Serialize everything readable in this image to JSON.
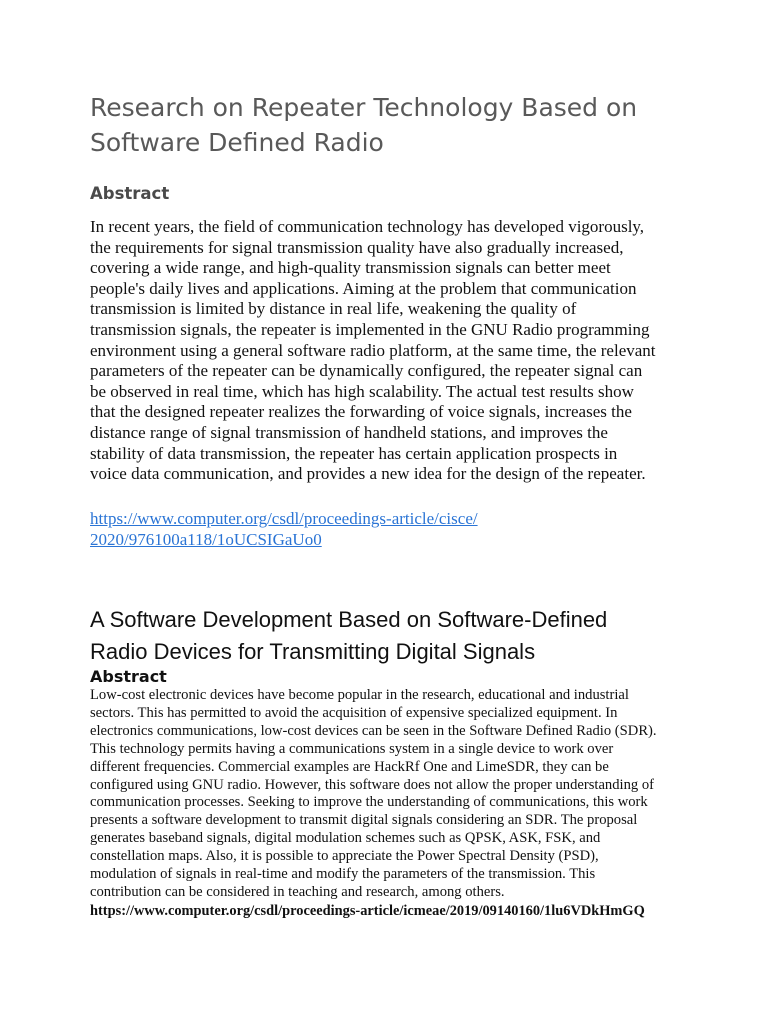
{
  "article1": {
    "title_lines": [
      "Research on Repeater Technology Based on",
      "Software Defined Radio"
    ],
    "abstract_heading": "Abstract",
    "abstract_lines": [
      "In recent years, the field of communication technology has developed vigorously,",
      "the requirements for signal transmission quality have also gradually increased,",
      "covering a wide range, and high-quality transmission signals can better meet",
      "people's daily lives and applications. Aiming at the problem that communication",
      "transmission is limited by distance in real life, weakening the quality of",
      "transmission signals, the repeater is implemented in the GNU Radio programming",
      "environment using a general software radio platform, at the same time, the relevant",
      "parameters of the repeater can be dynamically configured, the repeater signal can",
      "be observed in real time, which has high scalability. The actual test results show",
      "that the designed repeater realizes the forwarding of voice signals, increases the",
      "distance range of signal transmission of handheld stations, and improves the",
      "stability of data transmission, the repeater has certain application prospects in",
      "voice data communication, and provides a new idea for the design of the repeater."
    ],
    "link_lines": [
      "https://www.computer.org/csdl/proceedings-article/cisce/",
      "2020/976100a118/1oUCSIGaUo0"
    ]
  },
  "article2": {
    "title_lines": [
      "A Software Development Based on Software-Defined",
      "Radio Devices for Transmitting Digital Signals"
    ],
    "abstract_heading": "Abstract",
    "abstract_lines": [
      "Low-cost electronic devices have become popular in the research, educational and industrial",
      "sectors. This has permitted to avoid the acquisition of expensive specialized equipment. In",
      "electronics communications, low-cost devices can be seen in the Software Defined Radio (SDR).",
      "This technology permits having a communications system in a single device to work over",
      "different frequencies. Commercial examples are HackRf One and LimeSDR, they can be",
      "configured using GNU radio. However, this software does not allow the proper understanding of",
      "communication processes. Seeking to improve the understanding of communications, this work",
      "presents a software development to transmit digital signals considering an SDR. The proposal",
      "generates baseband signals, digital modulation schemes such as QPSK, ASK, FSK, and",
      "constellation maps. Also, it is possible to appreciate the Power Spectral Density (PSD),",
      "modulation of signals in real-time and modify the parameters of the transmission. This",
      "contribution can be considered in teaching and research, among others."
    ],
    "link": "https://www.computer.org/csdl/proceedings-article/icmeae/2019/09140160/1lu6VDkHmGQ"
  }
}
